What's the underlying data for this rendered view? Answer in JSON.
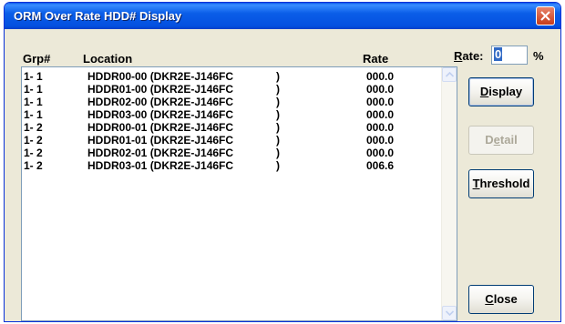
{
  "window": {
    "title": "ORM Over Rate HDD# Display"
  },
  "columns": {
    "grp": "Grp#",
    "location": "Location",
    "rate": "Rate"
  },
  "rows": [
    {
      "grp": "1- 1",
      "location": "HDDR00-00 (DKR2E-J146FC",
      "close": ")",
      "rate": "000.0"
    },
    {
      "grp": "1- 1",
      "location": "HDDR01-00 (DKR2E-J146FC",
      "close": ")",
      "rate": "000.0"
    },
    {
      "grp": "1- 1",
      "location": "HDDR02-00 (DKR2E-J146FC",
      "close": ")",
      "rate": "000.0"
    },
    {
      "grp": "1- 1",
      "location": "HDDR03-00 (DKR2E-J146FC",
      "close": ")",
      "rate": "000.0"
    },
    {
      "grp": "1- 2",
      "location": "HDDR00-01 (DKR2E-J146FC",
      "close": ")",
      "rate": "000.0"
    },
    {
      "grp": "1- 2",
      "location": "HDDR01-01 (DKR2E-J146FC",
      "close": ")",
      "rate": "000.0"
    },
    {
      "grp": "1- 2",
      "location": "HDDR02-01 (DKR2E-J146FC",
      "close": ")",
      "rate": "000.0"
    },
    {
      "grp": "1- 2",
      "location": "HDDR03-01 (DKR2E-J146FC",
      "close": ")",
      "rate": "006.6"
    }
  ],
  "rate_filter": {
    "label_first": "R",
    "label_rest": "ate:",
    "value": "0",
    "unit": "%"
  },
  "buttons": {
    "display": {
      "mnemonic": "D",
      "rest": "isplay"
    },
    "detail": {
      "pre": "D",
      "mnemonic": "e",
      "rest": "tail",
      "enabled": false
    },
    "threshold": {
      "mnemonic": "T",
      "rest": "hreshold"
    },
    "close": {
      "mnemonic": "C",
      "rest": "lose"
    }
  },
  "icons": {
    "close": "close-x-icon",
    "scroll_up": "arrow-up-icon",
    "scroll_down": "arrow-down-icon"
  }
}
